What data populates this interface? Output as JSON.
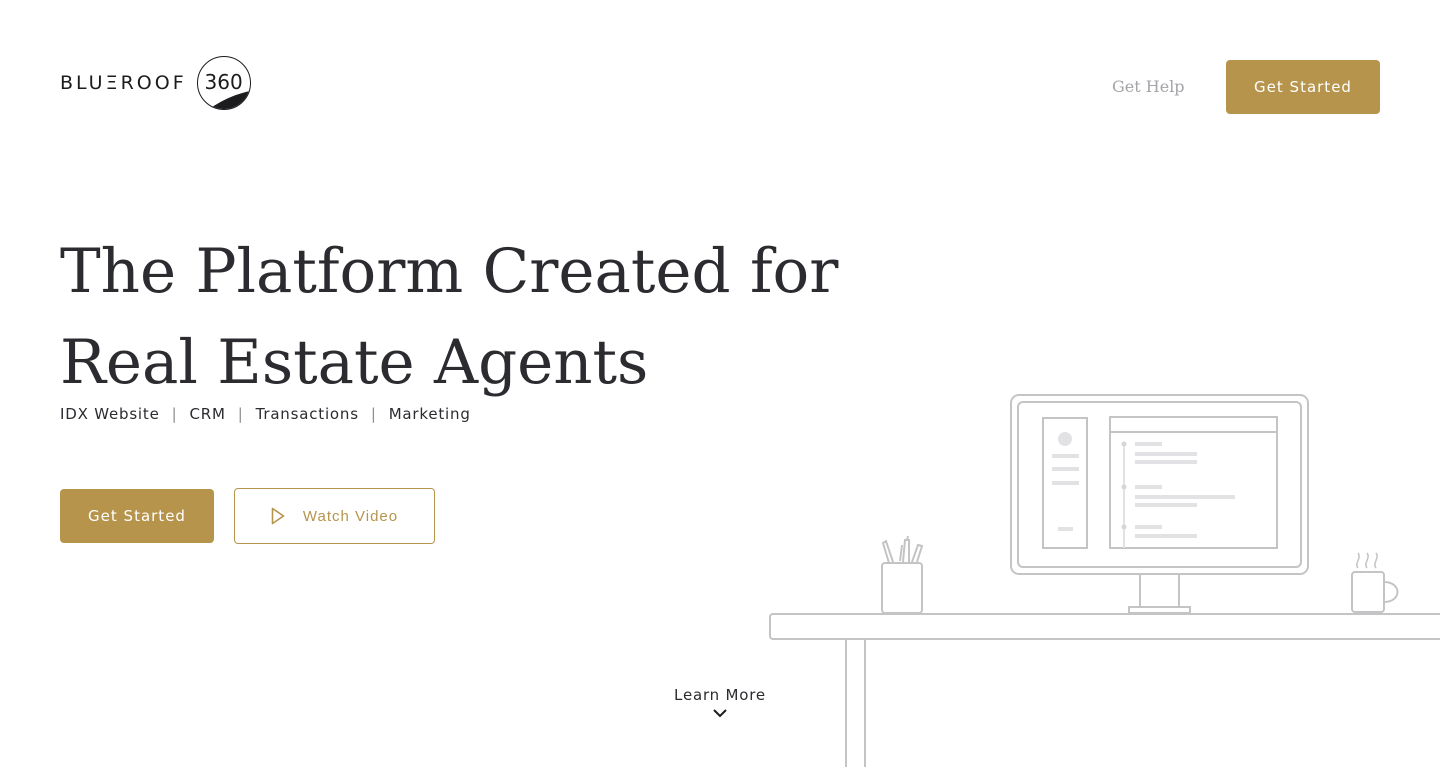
{
  "header": {
    "logo_word": "BLUΞROOF",
    "logo_number": "360",
    "get_help": "Get Help",
    "cta": "Get Started"
  },
  "hero": {
    "title_line1": "The Platform Created for",
    "title_line2": "Real Estate Agents",
    "features": [
      "IDX Website",
      "CRM",
      "Transactions",
      "Marketing"
    ],
    "separator": "|",
    "cta": "Get Started",
    "video_button": "Watch Video"
  },
  "learn_more": "Learn More",
  "colors": {
    "accent": "#b6944b",
    "text": "#2b2b30",
    "muted": "#a3a3a8",
    "illustration_stroke": "#c4c4c6"
  },
  "icons": {
    "play": "play-icon",
    "chevron": "chevron-down-icon"
  }
}
